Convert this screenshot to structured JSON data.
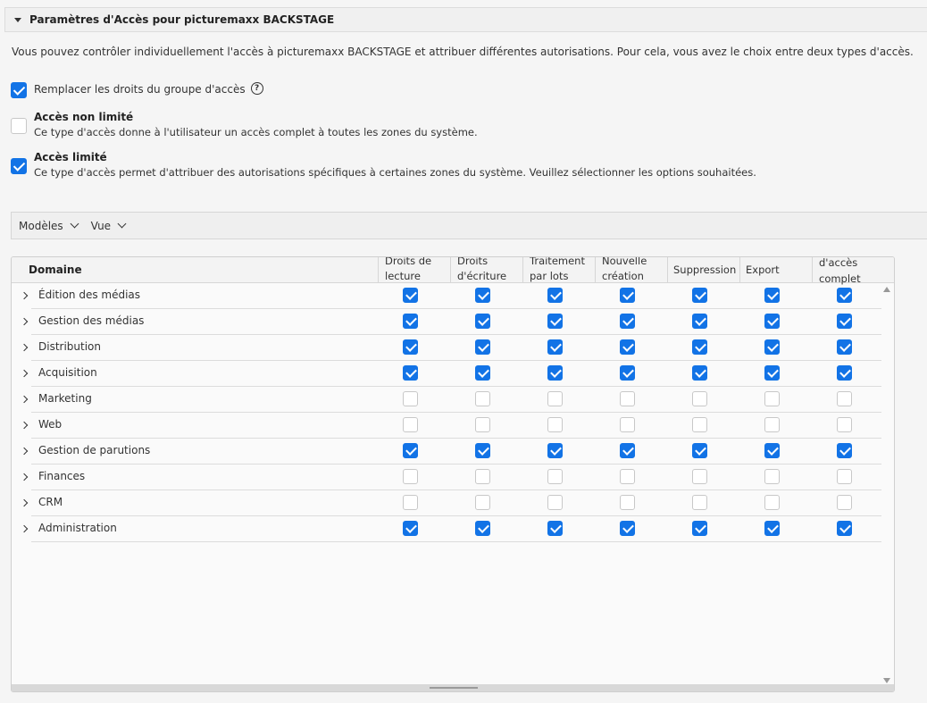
{
  "section": {
    "title": "Paramètres d'Accès pour picturemaxx BACKSTAGE",
    "intro": "Vous pouvez contrôler individuellement l'accès à picturemaxx BACKSTAGE et attribuer différentes autorisations. Pour cela, vous avez le choix entre deux types d'accès."
  },
  "override": {
    "label": "Remplacer les droits du groupe d'accès",
    "checked": true,
    "help_icon": "question-circle-icon"
  },
  "unlimited": {
    "title": "Accès non limité",
    "desc": "Ce type d'accès donne à l'utilisateur un accès complet à toutes les zones du système.",
    "checked": false
  },
  "limited": {
    "title": "Accès limité",
    "desc": "Ce type d'accès permet d'attribuer des autorisations spécifiques à certaines zones du système. Veuillez sélectionner les options souhaitées.",
    "checked": true
  },
  "toolbar": {
    "models": "Modèles",
    "view": "Vue"
  },
  "grid": {
    "domain_header": "Domaine",
    "columns": [
      {
        "line1": "Droits de",
        "line2": "lecture"
      },
      {
        "line1": "Droits",
        "line2": "d'écriture"
      },
      {
        "line1": "Traitement",
        "line2": "par lots"
      },
      {
        "line1": "Nouvelle",
        "line2": "création"
      },
      {
        "line1": "Suppression",
        "line2": ""
      },
      {
        "line1": "Export",
        "line2": ""
      },
      {
        "line1": "d'accès",
        "line2": "complet"
      }
    ],
    "rows": [
      {
        "label": "Édition des médias",
        "checked": true
      },
      {
        "label": "Gestion des médias",
        "checked": true
      },
      {
        "label": "Distribution",
        "checked": true
      },
      {
        "label": "Acquisition",
        "checked": true
      },
      {
        "label": "Marketing",
        "checked": false
      },
      {
        "label": "Web",
        "checked": false
      },
      {
        "label": "Gestion de parutions",
        "checked": true
      },
      {
        "label": "Finances",
        "checked": false
      },
      {
        "label": "CRM",
        "checked": false
      },
      {
        "label": "Administration",
        "checked": true
      }
    ]
  },
  "colors": {
    "accent": "#1273e6"
  }
}
